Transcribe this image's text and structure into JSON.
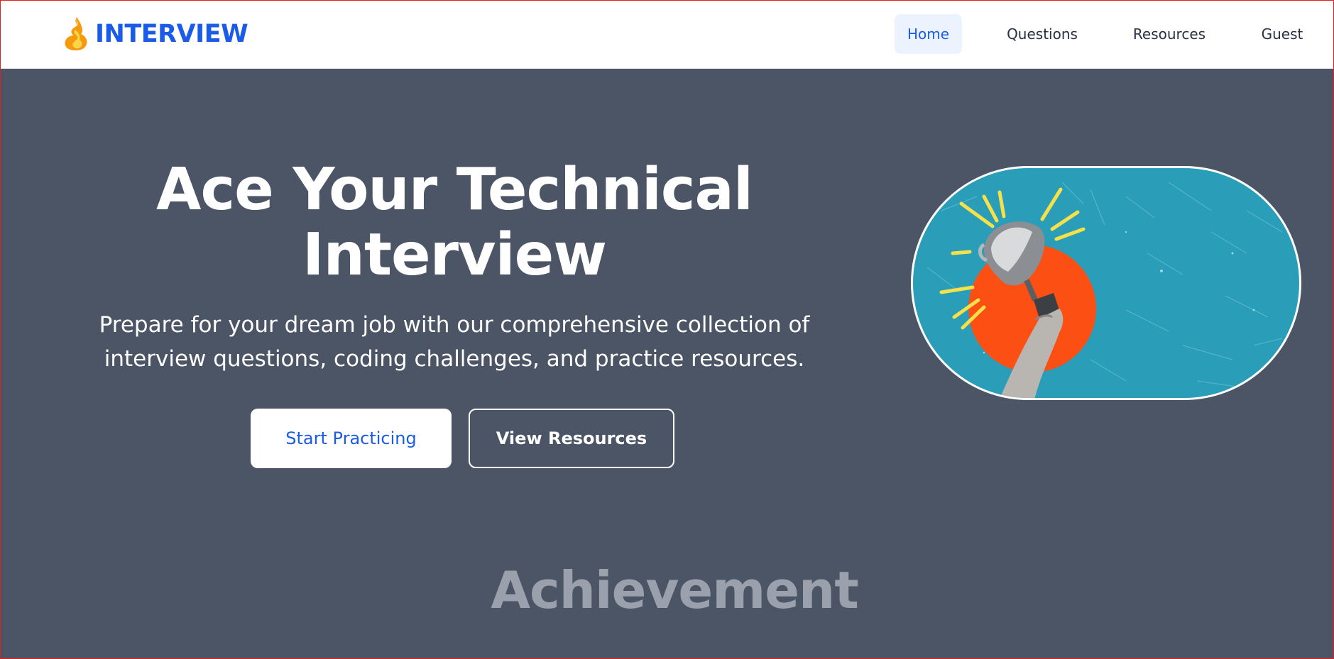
{
  "brand": {
    "name": "INTERVIEW",
    "icon": "flame-logo-icon",
    "color": "#1a5ce8"
  },
  "nav": {
    "items": [
      {
        "label": "Home",
        "active": true
      },
      {
        "label": "Questions",
        "active": false
      },
      {
        "label": "Resources",
        "active": false
      },
      {
        "label": "Guest",
        "active": false
      }
    ]
  },
  "hero": {
    "title_line1": "Ace Your Technical",
    "title_line2": "Interview",
    "subtitle_line1": "Prepare for your dream job with our comprehensive collection of",
    "subtitle_line2": "interview questions, coding challenges, and practice resources.",
    "primary_button": "Start Practicing",
    "secondary_button": "View Resources",
    "image": "trophy-hand-illustration",
    "background_color": "#4b5565"
  },
  "achievement": {
    "title": "Achievement"
  }
}
